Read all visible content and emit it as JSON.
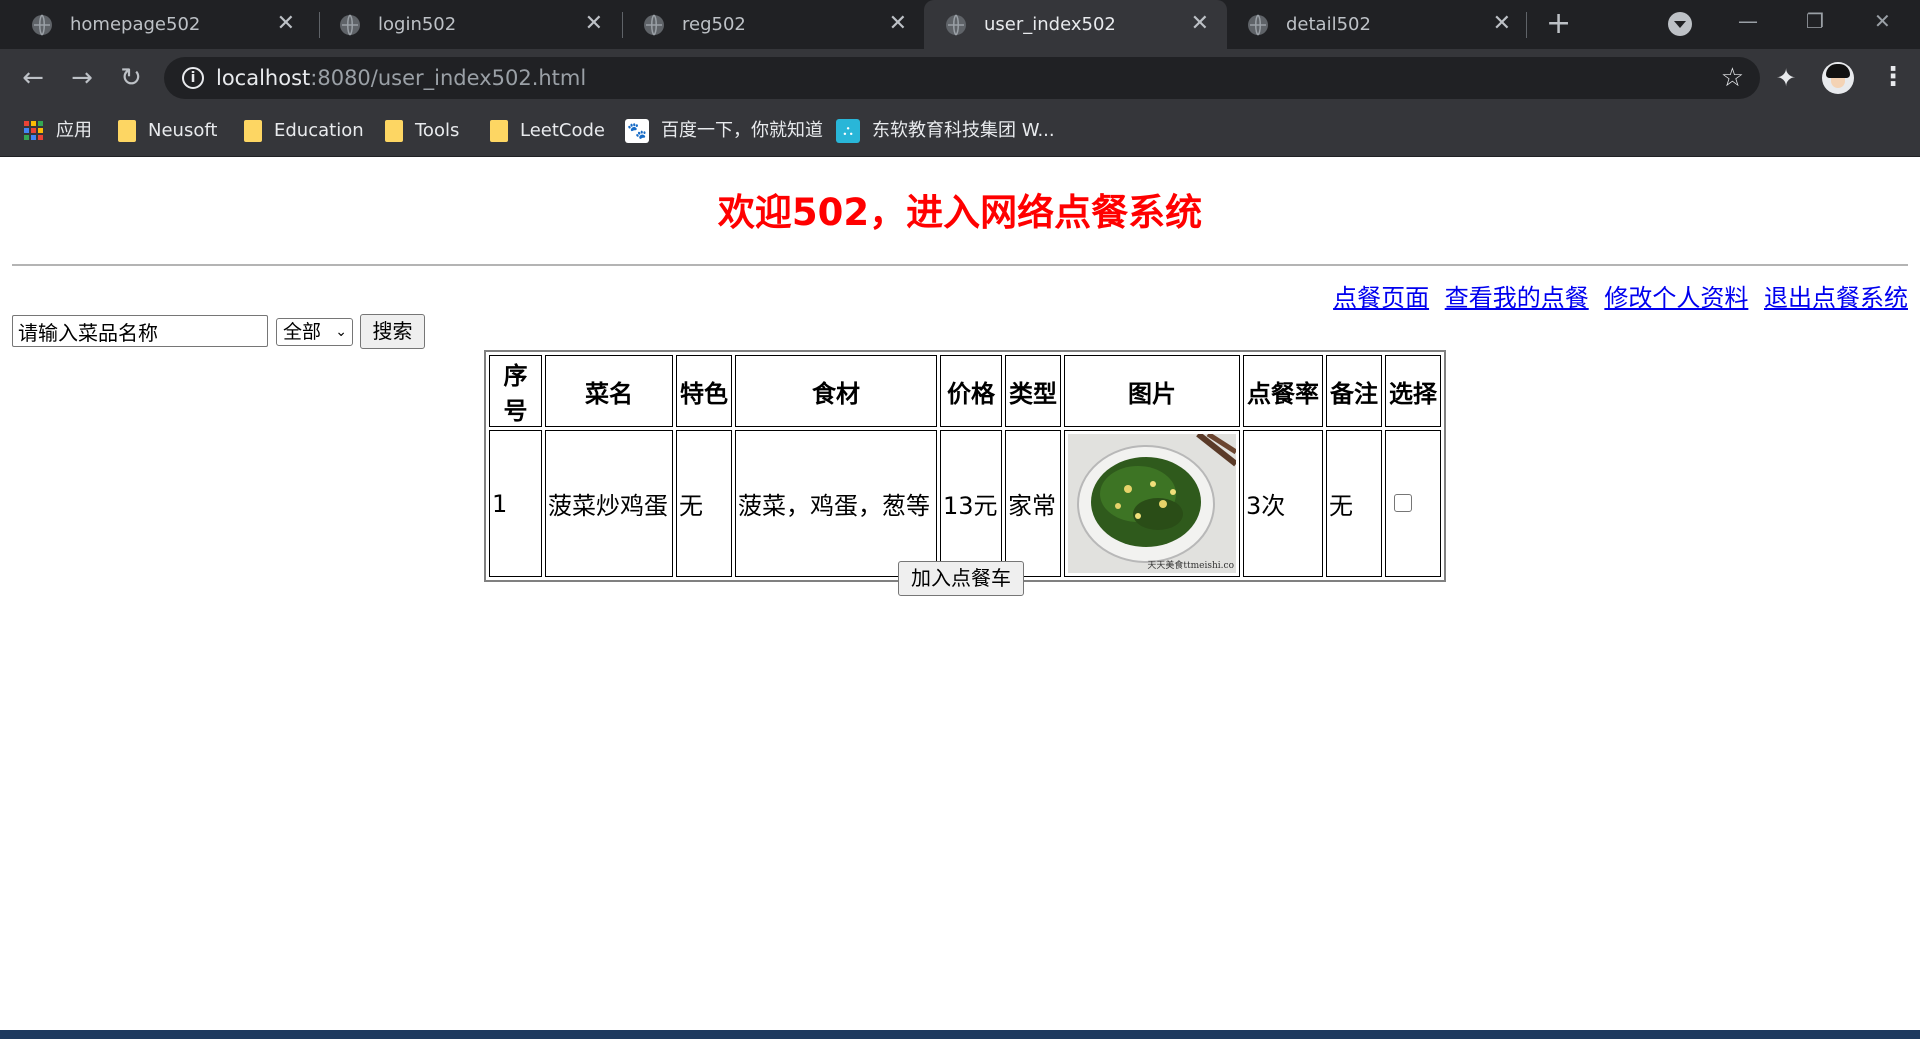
{
  "browser": {
    "tabs": [
      {
        "title": "homepage502",
        "active": false
      },
      {
        "title": "login502",
        "active": false
      },
      {
        "title": "reg502",
        "active": false
      },
      {
        "title": "user_index502",
        "active": true
      },
      {
        "title": "detail502",
        "active": false
      }
    ],
    "url_host": "localhost",
    "url_rest": ":8080/user_index502.html",
    "bookmarks": [
      {
        "label": "应用",
        "icon": "apps-grid-icon"
      },
      {
        "label": "Neusoft",
        "icon": "folder-icon"
      },
      {
        "label": "Education",
        "icon": "folder-icon"
      },
      {
        "label": "Tools",
        "icon": "folder-icon"
      },
      {
        "label": "LeetCode",
        "icon": "folder-icon"
      },
      {
        "label": "百度一下，你就知道",
        "icon": "baidu-paw-icon"
      },
      {
        "label": "东软教育科技集团 W...",
        "icon": "neusoft-icon"
      }
    ]
  },
  "page": {
    "title": "欢迎502，进入网络点餐系统",
    "links": [
      "点餐页面",
      "查看我的点餐",
      "修改个人资料",
      "退出点餐系统"
    ],
    "search": {
      "value": "请输入菜品名称",
      "category_selected": "全部",
      "button_label": "搜索"
    },
    "table": {
      "headers": [
        "序号",
        "菜名",
        "特色",
        "食材",
        "价格",
        "类型",
        "图片",
        "点餐率",
        "备注",
        "选择"
      ],
      "rows": [
        {
          "id": "1",
          "name": "菠菜炒鸡蛋",
          "feature": "无",
          "ingredients": "菠菜，鸡蛋，葱等",
          "price": "13元",
          "type": "家常",
          "image_caption": "天天美食ttmeishi.co",
          "order_rate": "3次",
          "note": "无",
          "selected": false
        }
      ]
    },
    "cart_button": "加入点餐车"
  },
  "colors": {
    "title_red": "#ff0000",
    "link_blue": "#0000ee",
    "chrome_dark": "#202124",
    "chrome_toolbar": "#35363a"
  }
}
